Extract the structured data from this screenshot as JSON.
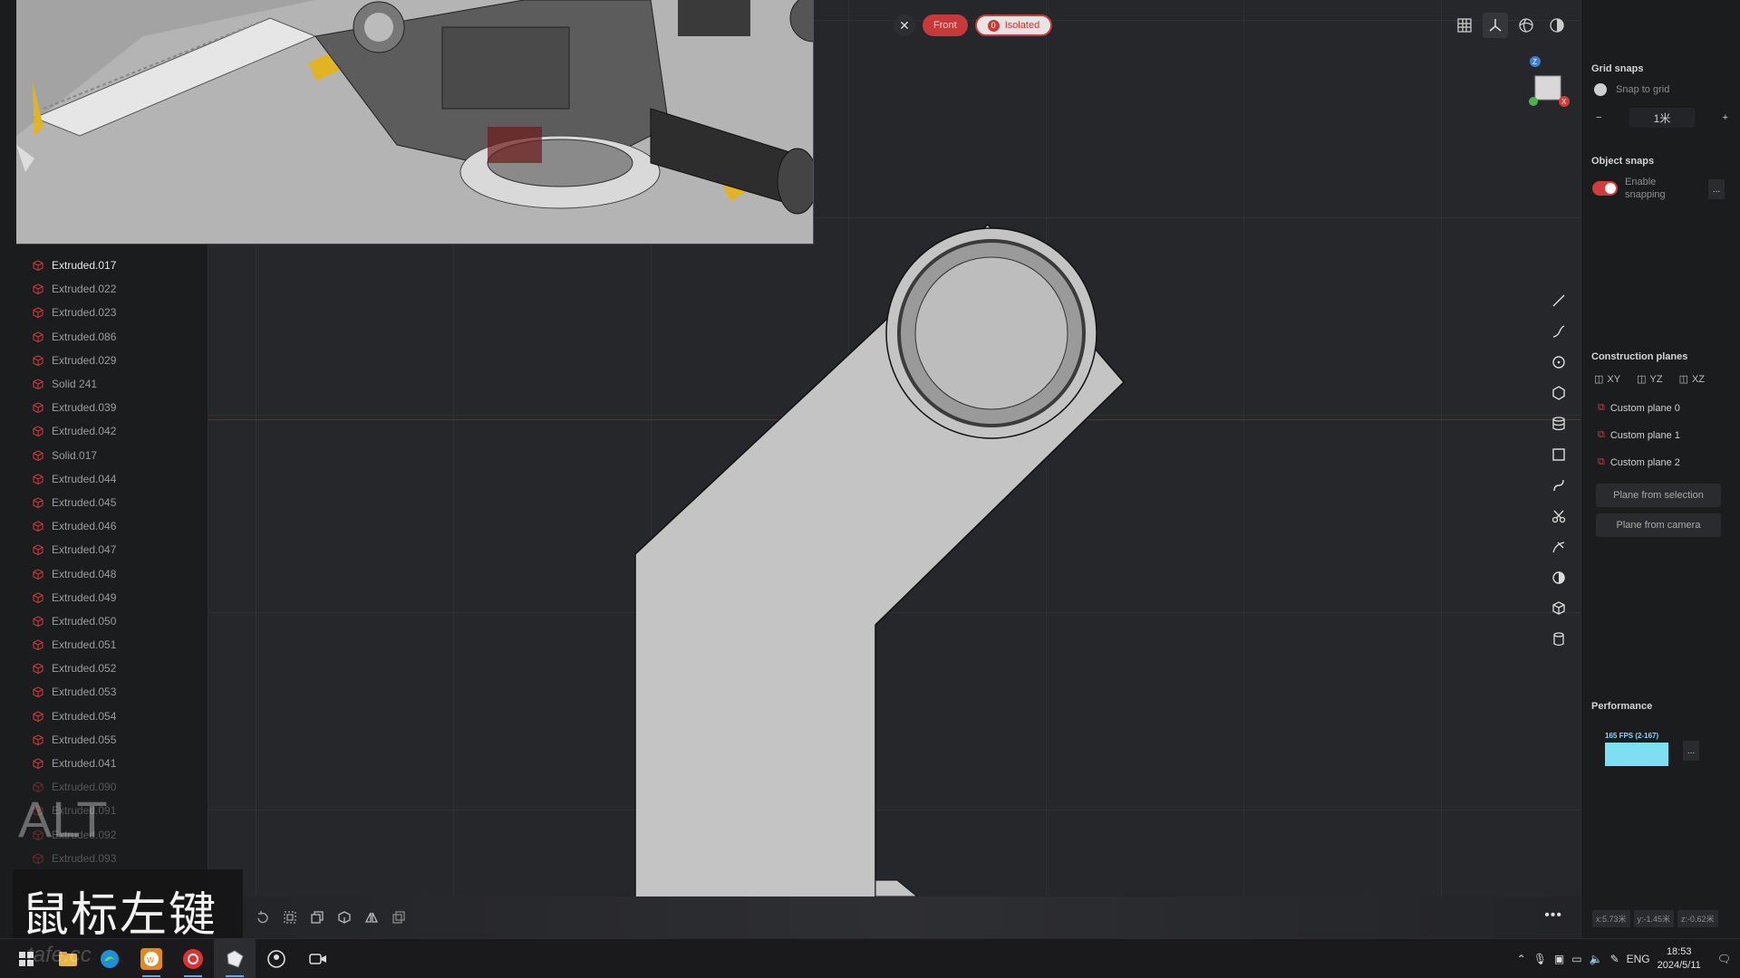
{
  "view": {
    "close_label": "✕",
    "front_label": "Front",
    "isolated_count": "0",
    "isolated_label": "Isolated"
  },
  "window_controls": {
    "minimize": "—",
    "maximize": "☐",
    "close": "✕"
  },
  "nav_gizmo": {
    "up_axis": "Z",
    "x_axis": "X"
  },
  "outliner": {
    "items": [
      {
        "label": "Extruded.017",
        "state": "active"
      },
      {
        "label": "Extruded.022",
        "state": "normal"
      },
      {
        "label": "Extruded.023",
        "state": "normal"
      },
      {
        "label": "Extruded.086",
        "state": "normal"
      },
      {
        "label": "Extruded.029",
        "state": "normal"
      },
      {
        "label": "Solid 241",
        "state": "normal"
      },
      {
        "label": "Extruded.039",
        "state": "normal"
      },
      {
        "label": "Extruded.042",
        "state": "normal"
      },
      {
        "label": "Solid.017",
        "state": "normal"
      },
      {
        "label": "Extruded.044",
        "state": "normal"
      },
      {
        "label": "Extruded.045",
        "state": "normal"
      },
      {
        "label": "Extruded.046",
        "state": "normal"
      },
      {
        "label": "Extruded.047",
        "state": "normal"
      },
      {
        "label": "Extruded.048",
        "state": "normal"
      },
      {
        "label": "Extruded.049",
        "state": "normal"
      },
      {
        "label": "Extruded.050",
        "state": "normal"
      },
      {
        "label": "Extruded.051",
        "state": "normal"
      },
      {
        "label": "Extruded.052",
        "state": "normal"
      },
      {
        "label": "Extruded.053",
        "state": "normal"
      },
      {
        "label": "Extruded.054",
        "state": "normal"
      },
      {
        "label": "Extruded.055",
        "state": "normal"
      },
      {
        "label": "Extruded.041",
        "state": "normal"
      },
      {
        "label": "Extruded.090",
        "state": "faded"
      },
      {
        "label": "Extruded.091",
        "state": "faded"
      },
      {
        "label": "Extruded.092",
        "state": "faded"
      },
      {
        "label": "Extruded.093",
        "state": "faded"
      }
    ]
  },
  "right_panel": {
    "grid_snaps": {
      "title": "Grid snaps",
      "snap_to_grid_label": "Snap to grid",
      "snap_to_grid_on": false,
      "minus": "−",
      "value": "1米",
      "plus": "+"
    },
    "object_snaps": {
      "title": "Object snaps",
      "enable_label": "Enable snapping",
      "enable_on": true,
      "more": "..."
    },
    "construction_planes": {
      "title": "Construction planes",
      "axes": [
        "XY",
        "YZ",
        "XZ"
      ],
      "custom_planes": [
        "Custom plane 0",
        "Custom plane 1",
        "Custom plane 2"
      ],
      "from_selection": "Plane from selection",
      "from_camera": "Plane from camera"
    },
    "performance": {
      "title": "Performance",
      "fps_label": "165 FPS (2-167)",
      "more": "..."
    },
    "coords": {
      "x": "x:5.73米",
      "y": "y:-1.45米",
      "z": "z:-0.62米"
    }
  },
  "bottom_toolbar": {
    "more": "•••"
  },
  "overlay": {
    "key_text": "鼠标左键",
    "alt_key": "ALT",
    "watermark": "tafe.cc"
  },
  "taskbar": {
    "language": "ENG",
    "time": "18:53",
    "date": "2024/5/11"
  },
  "colors": {
    "accent_red": "#c83a3a",
    "fps_bar": "#7fdff2",
    "viewport_bg": "#26272a"
  }
}
